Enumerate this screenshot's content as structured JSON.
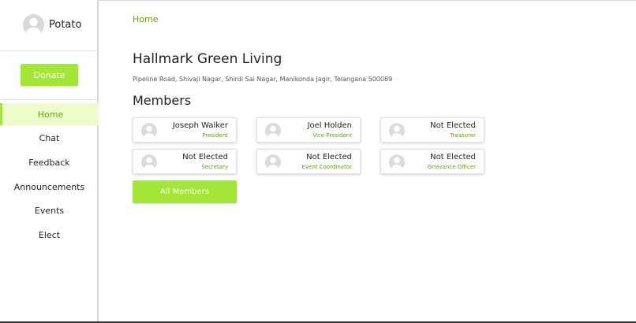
{
  "profile": {
    "name": "Potato"
  },
  "donate_label": "Donate",
  "nav": [
    {
      "label": "Home",
      "active": true
    },
    {
      "label": "Chat"
    },
    {
      "label": "Feedback"
    },
    {
      "label": "Announcements"
    },
    {
      "label": "Events"
    },
    {
      "label": "Elect"
    }
  ],
  "breadcrumb": "Home",
  "community": {
    "name": "Hallmark Green Living",
    "address": "Pipeline Road, Shivaji Nagar, Shirdi Sai Nagar, Manikonda Jagir, Telangana 500089"
  },
  "members_heading": "Members",
  "members": [
    {
      "name": "Joseph Walker",
      "role": "President"
    },
    {
      "name": "Joel Holden",
      "role": "Vice President"
    },
    {
      "name": "Not Elected",
      "role": "Treasurer"
    },
    {
      "name": "Not Elected",
      "role": "Secretary"
    },
    {
      "name": "Not Elected",
      "role": "Event Coordinator"
    },
    {
      "name": "Not Elected",
      "role": "Grievance Officer"
    }
  ],
  "all_members_label": "All Members",
  "colors": {
    "accent": "#a3e635",
    "accent_text": "#65a30d",
    "active_bg": "#ecfccb"
  }
}
